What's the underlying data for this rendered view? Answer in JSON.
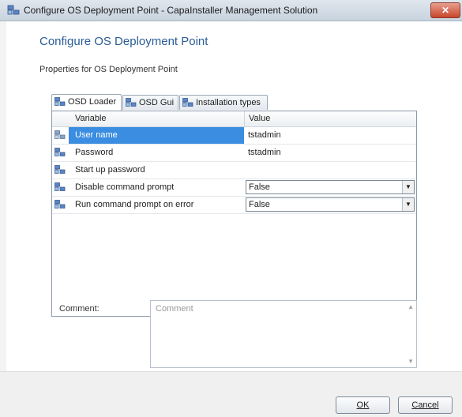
{
  "window": {
    "title": "Configure OS Deployment Point - CapaInstaller Management Solution",
    "close_glyph": "✕"
  },
  "dialog": {
    "heading": "Configure OS Deployment Point",
    "subheading": "Properties for OS Deployment Point"
  },
  "tabs": [
    {
      "label": "OSD Loader",
      "icon": "computer-group-icon",
      "active": true
    },
    {
      "label": "OSD Gui",
      "icon": "computer-group-icon",
      "active": false
    },
    {
      "label": "Installation types",
      "icon": "computer-group-icon",
      "active": false
    }
  ],
  "grid": {
    "columns": [
      "Variable",
      "Value"
    ],
    "rows": [
      {
        "name": "User name",
        "value": "tstadmin",
        "type": "text",
        "selected": true
      },
      {
        "name": "Password",
        "value": "tstadmin",
        "type": "text",
        "selected": false
      },
      {
        "name": "Start up password",
        "value": "",
        "type": "text",
        "selected": false
      },
      {
        "name": "Disable command prompt",
        "value": "False",
        "type": "combo",
        "selected": false
      },
      {
        "name": "Run command prompt on error",
        "value": "False",
        "type": "combo",
        "selected": false
      }
    ]
  },
  "comment": {
    "label": "Comment:",
    "placeholder": "Comment"
  },
  "buttons": {
    "ok_label": "OK",
    "cancel_label": "Cancel"
  },
  "colors": {
    "heading": "#2a5c96",
    "selection": "#3a8de0",
    "close": "#c8452c"
  }
}
